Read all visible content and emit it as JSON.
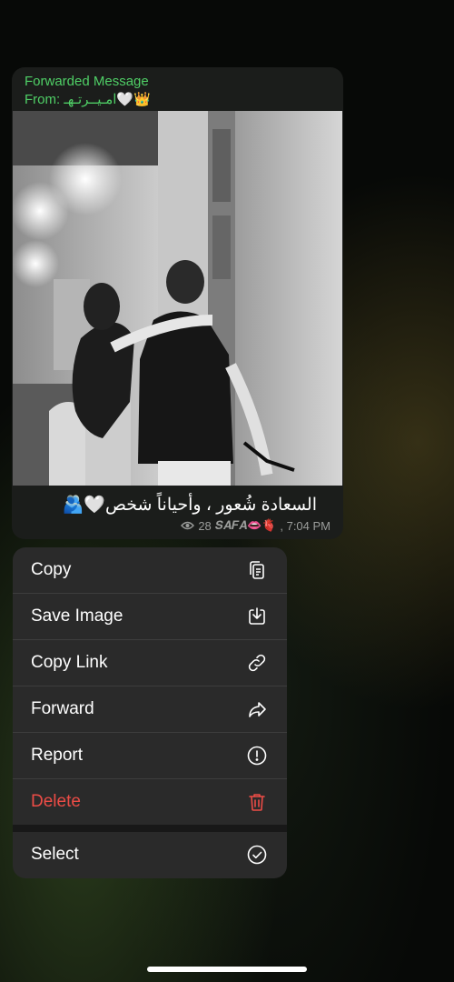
{
  "message": {
    "forwarded_label": "Forwarded Message",
    "from_label": "From:",
    "from_name": "امـيـ‍ـرتـهـ",
    "from_emojis": "🤍👑",
    "caption": "السعادة شُعور ، وأحياناً شخص🤍🫂",
    "views": "28",
    "signature": "𝑺𝑨𝑭𝑨👄🫀",
    "time": ", 7:04 PM",
    "photo_description": "Black-and-white photo of a man carrying a woman in an ornate hall with chandeliers"
  },
  "context_menu": {
    "items": [
      {
        "label": "Copy",
        "icon": "copy-icon"
      },
      {
        "label": "Save Image",
        "icon": "save-image-icon"
      },
      {
        "label": "Copy Link",
        "icon": "link-icon"
      },
      {
        "label": "Forward",
        "icon": "forward-icon"
      },
      {
        "label": "Report",
        "icon": "report-icon"
      },
      {
        "label": "Delete",
        "icon": "trash-icon",
        "color": "#ec4c46"
      },
      {
        "label": "Select",
        "icon": "select-check-icon"
      }
    ]
  },
  "colors": {
    "forward_header": "#4fcf66",
    "delete": "#ec4c46",
    "menu_background": "#2a2a2a"
  }
}
